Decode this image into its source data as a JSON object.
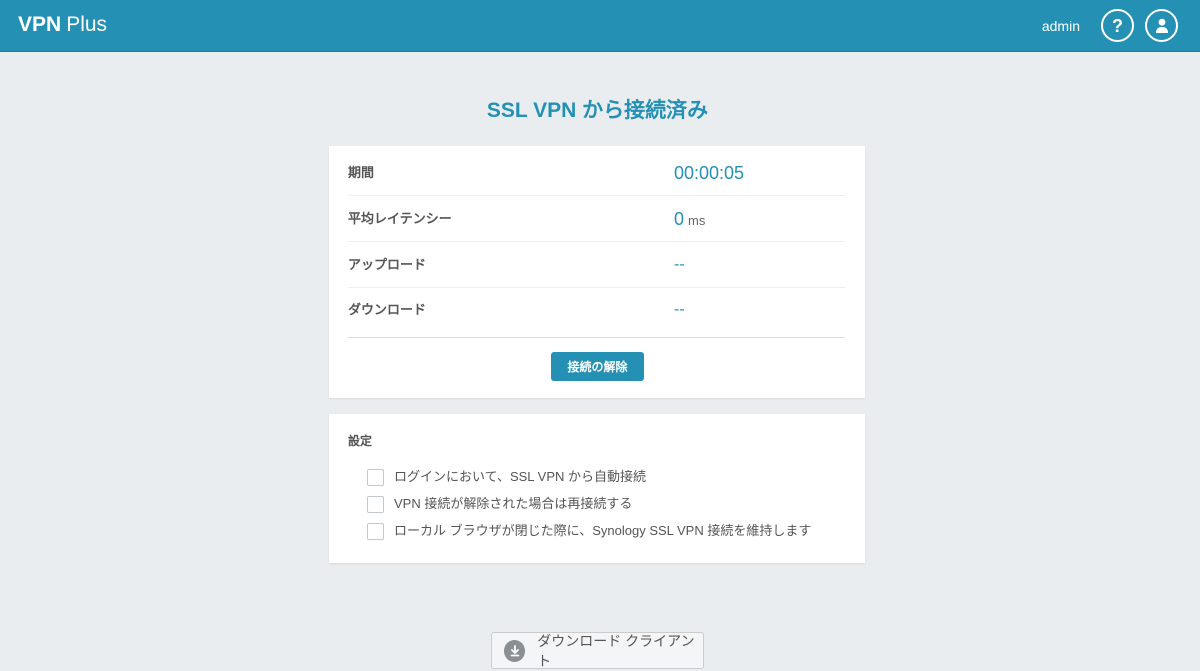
{
  "header": {
    "brand_bold": "VPN",
    "brand_regular": "Plus",
    "username": "admin"
  },
  "title": "SSL VPN から接続済み",
  "status": {
    "rows": [
      {
        "label": "期間",
        "value": "00:00:05"
      },
      {
        "label": "平均レイテンシー",
        "value": "0",
        "unit": "ms"
      },
      {
        "label": "アップロード",
        "value": "--"
      },
      {
        "label": "ダウンロード",
        "value": "--"
      }
    ],
    "disconnect_label": "接続の解除"
  },
  "settings": {
    "title": "設定",
    "options": [
      {
        "label": "ログインにおいて、SSL VPN から自動接続",
        "checked": false
      },
      {
        "label": "VPN 接続が解除された場合は再接続する",
        "checked": false
      },
      {
        "label": "ローカル ブラウザが閉じた際に、Synology SSL VPN 接続を維持します",
        "checked": false
      }
    ]
  },
  "download": {
    "label": "ダウンロード クライアント",
    "icon": "download-icon"
  },
  "colors": {
    "accent": "#2490b4",
    "background": "#e9edf0"
  }
}
